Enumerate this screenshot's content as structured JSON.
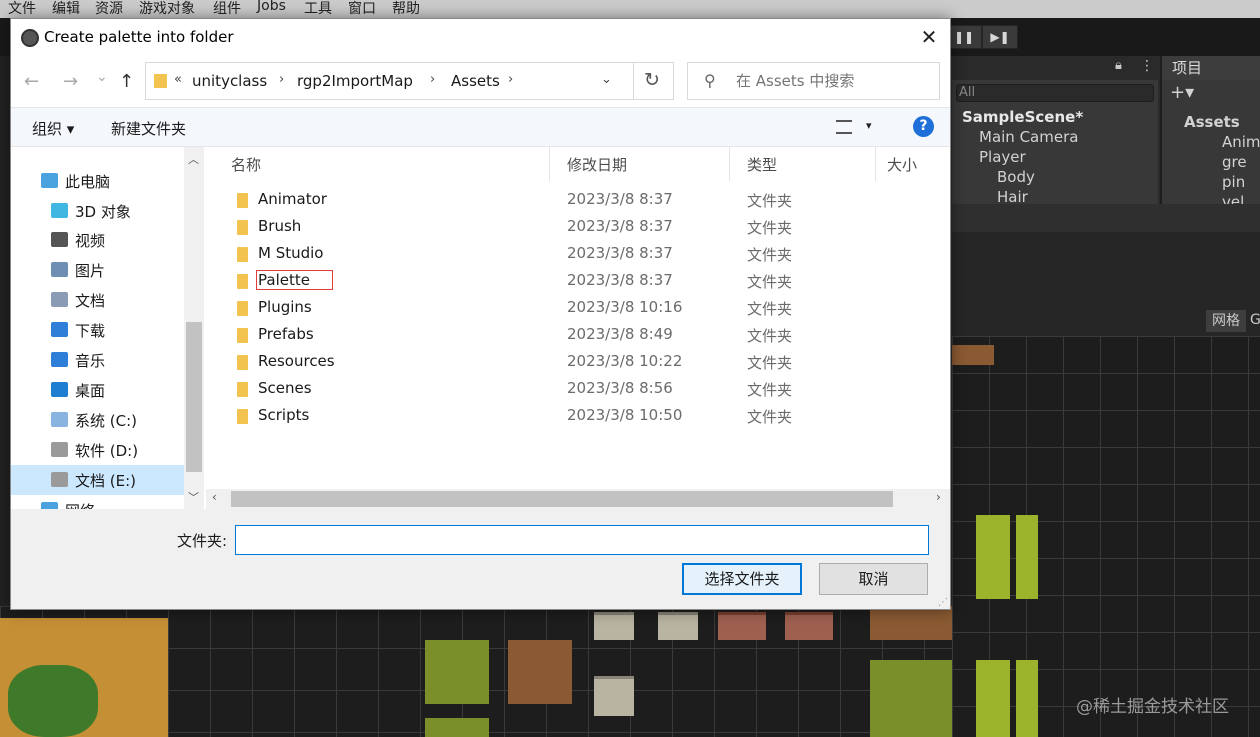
{
  "unity": {
    "menu": [
      "文件",
      "编辑",
      "资源",
      "游戏对象",
      "组件",
      "Jobs",
      "工具",
      "窗口",
      "帮助"
    ],
    "hierarchy": {
      "search_placeholder": "All",
      "scene": "SampleScene*",
      "rows": [
        "Main Camera",
        "Player",
        "Body",
        "Hair"
      ]
    },
    "project": {
      "tab": "项目",
      "root": "Assets",
      "rows": [
        "Anima",
        "gre",
        "pin",
        "vel"
      ]
    },
    "grid_button": "网格",
    "grid_button_extra": "G",
    "watermark": "@稀土掘金技术社区"
  },
  "dialog": {
    "title": "Create palette into folder",
    "close_glyph": "✕",
    "nav": {
      "back": "←",
      "forward": "→",
      "recent": "⌄",
      "up": "↑"
    },
    "breadcrumb": {
      "overflow": "«",
      "parts": [
        "unityclass",
        "rgp2ImportMap",
        "Assets"
      ],
      "sep": "›",
      "dropdown": "⌄",
      "refresh": "↻"
    },
    "search": {
      "placeholder": "在 Assets 中搜索",
      "icon": "⚲"
    },
    "commands": {
      "organize": "组织 ▾",
      "new_folder": "新建文件夹",
      "view_dd": "▾",
      "help": "?"
    },
    "nav_pane": [
      {
        "label": "此电脑",
        "color": "#4aa3df"
      },
      {
        "label": "3D 对象",
        "color": "#3fb7e0"
      },
      {
        "label": "视频",
        "color": "#555555"
      },
      {
        "label": "图片",
        "color": "#6e8fb3"
      },
      {
        "label": "文档",
        "color": "#8a9bb5"
      },
      {
        "label": "下载",
        "color": "#2f7fd8"
      },
      {
        "label": "音乐",
        "color": "#2f7fd8"
      },
      {
        "label": "桌面",
        "color": "#1e7fd0"
      },
      {
        "label": "系统 (C:)",
        "color": "#8ab4e0"
      },
      {
        "label": "软件 (D:)",
        "color": "#9a9a9a"
      },
      {
        "label": "文档 (E:)",
        "color": "#9a9a9a"
      },
      {
        "label": "网络",
        "color": "#4aa3df"
      }
    ],
    "nav_selected": 10,
    "scroll": {
      "up": "︿",
      "down": "﹀",
      "left": "‹",
      "right": "›"
    },
    "columns": {
      "name": "名称",
      "date": "修改日期",
      "type": "类型",
      "size": "大小",
      "sort_glyph": "^"
    },
    "files": [
      {
        "name": "Animator",
        "date": "2023/3/8 8:37",
        "type": "文件夹"
      },
      {
        "name": "Brush",
        "date": "2023/3/8 8:37",
        "type": "文件夹"
      },
      {
        "name": "M Studio",
        "date": "2023/3/8 8:37",
        "type": "文件夹"
      },
      {
        "name": "Palette",
        "date": "2023/3/8 8:37",
        "type": "文件夹"
      },
      {
        "name": "Plugins",
        "date": "2023/3/8 10:16",
        "type": "文件夹"
      },
      {
        "name": "Prefabs",
        "date": "2023/3/8 8:49",
        "type": "文件夹"
      },
      {
        "name": "Resources",
        "date": "2023/3/8 10:22",
        "type": "文件夹"
      },
      {
        "name": "Scenes",
        "date": "2023/3/8 8:56",
        "type": "文件夹"
      },
      {
        "name": "Scripts",
        "date": "2023/3/8 10:50",
        "type": "文件夹"
      }
    ],
    "renaming_index": 3,
    "folder_label": "文件夹:",
    "folder_value": "",
    "select_button": "选择文件夹",
    "cancel_button": "取消"
  }
}
